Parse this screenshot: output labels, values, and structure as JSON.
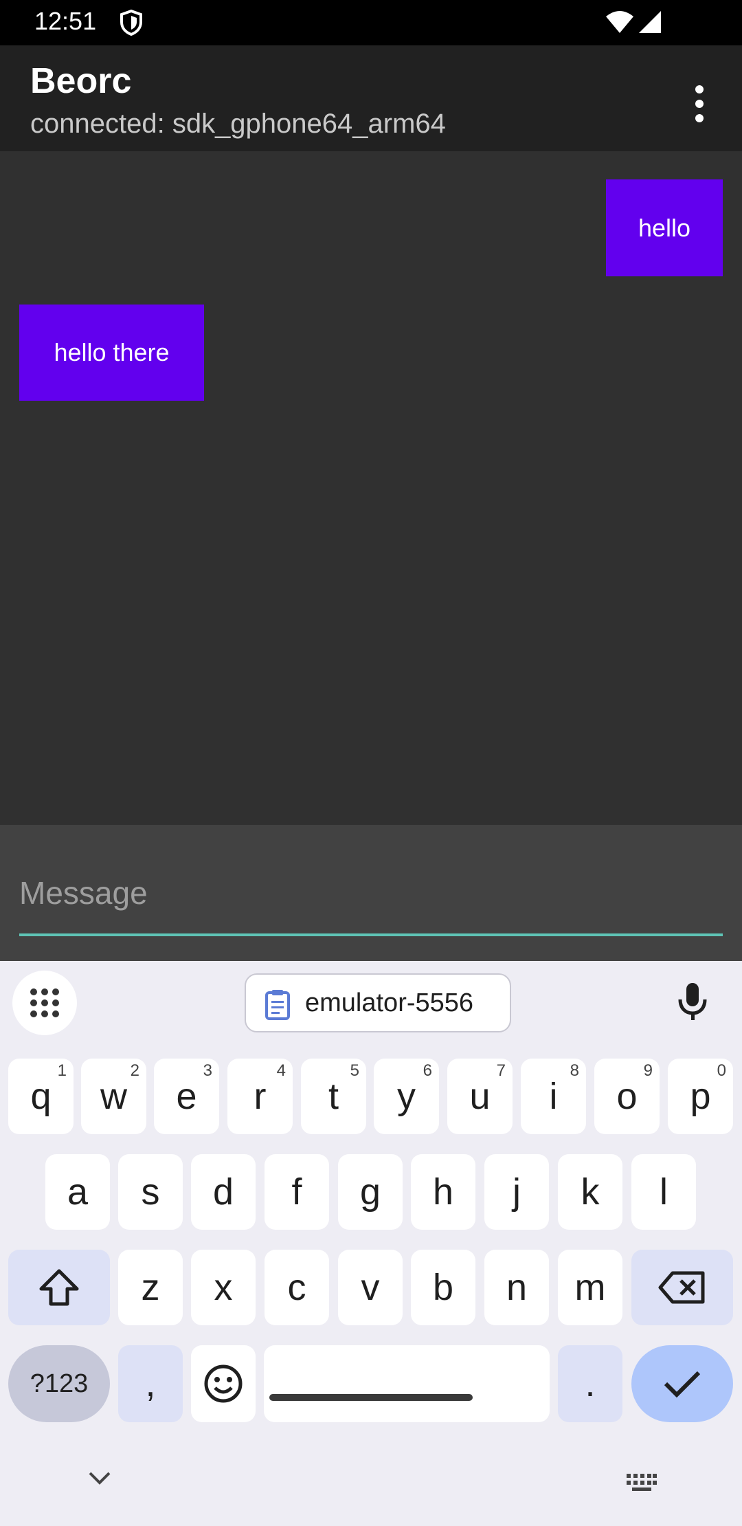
{
  "status_bar": {
    "time": "12:51",
    "icons": [
      "shield-icon",
      "wifi-icon",
      "signal-icon"
    ]
  },
  "app_bar": {
    "title": "Beorc",
    "subtitle": "connected: sdk_gphone64_arm64",
    "menu_icon": "more-vert-icon"
  },
  "messages": [
    {
      "direction": "outgoing",
      "text": "hello"
    },
    {
      "direction": "incoming",
      "text": "hello there"
    }
  ],
  "composer": {
    "placeholder": "Message",
    "value": ""
  },
  "keyboard": {
    "clipboard_suggestion": "emulator-5556",
    "row1": [
      {
        "key": "q",
        "hint": "1"
      },
      {
        "key": "w",
        "hint": "2"
      },
      {
        "key": "e",
        "hint": "3"
      },
      {
        "key": "r",
        "hint": "4"
      },
      {
        "key": "t",
        "hint": "5"
      },
      {
        "key": "y",
        "hint": "6"
      },
      {
        "key": "u",
        "hint": "7"
      },
      {
        "key": "i",
        "hint": "8"
      },
      {
        "key": "o",
        "hint": "9"
      },
      {
        "key": "p",
        "hint": "0"
      }
    ],
    "row2": [
      "a",
      "s",
      "d",
      "f",
      "g",
      "h",
      "j",
      "k",
      "l"
    ],
    "row3": [
      "z",
      "x",
      "c",
      "v",
      "b",
      "n",
      "m"
    ],
    "symbols_label": "?123",
    "comma": ",",
    "period": "."
  },
  "colors": {
    "bubble": "#6200ee",
    "accent_underline": "#5ec4b6",
    "chat_background": "#303030",
    "app_bar": "#212121"
  }
}
